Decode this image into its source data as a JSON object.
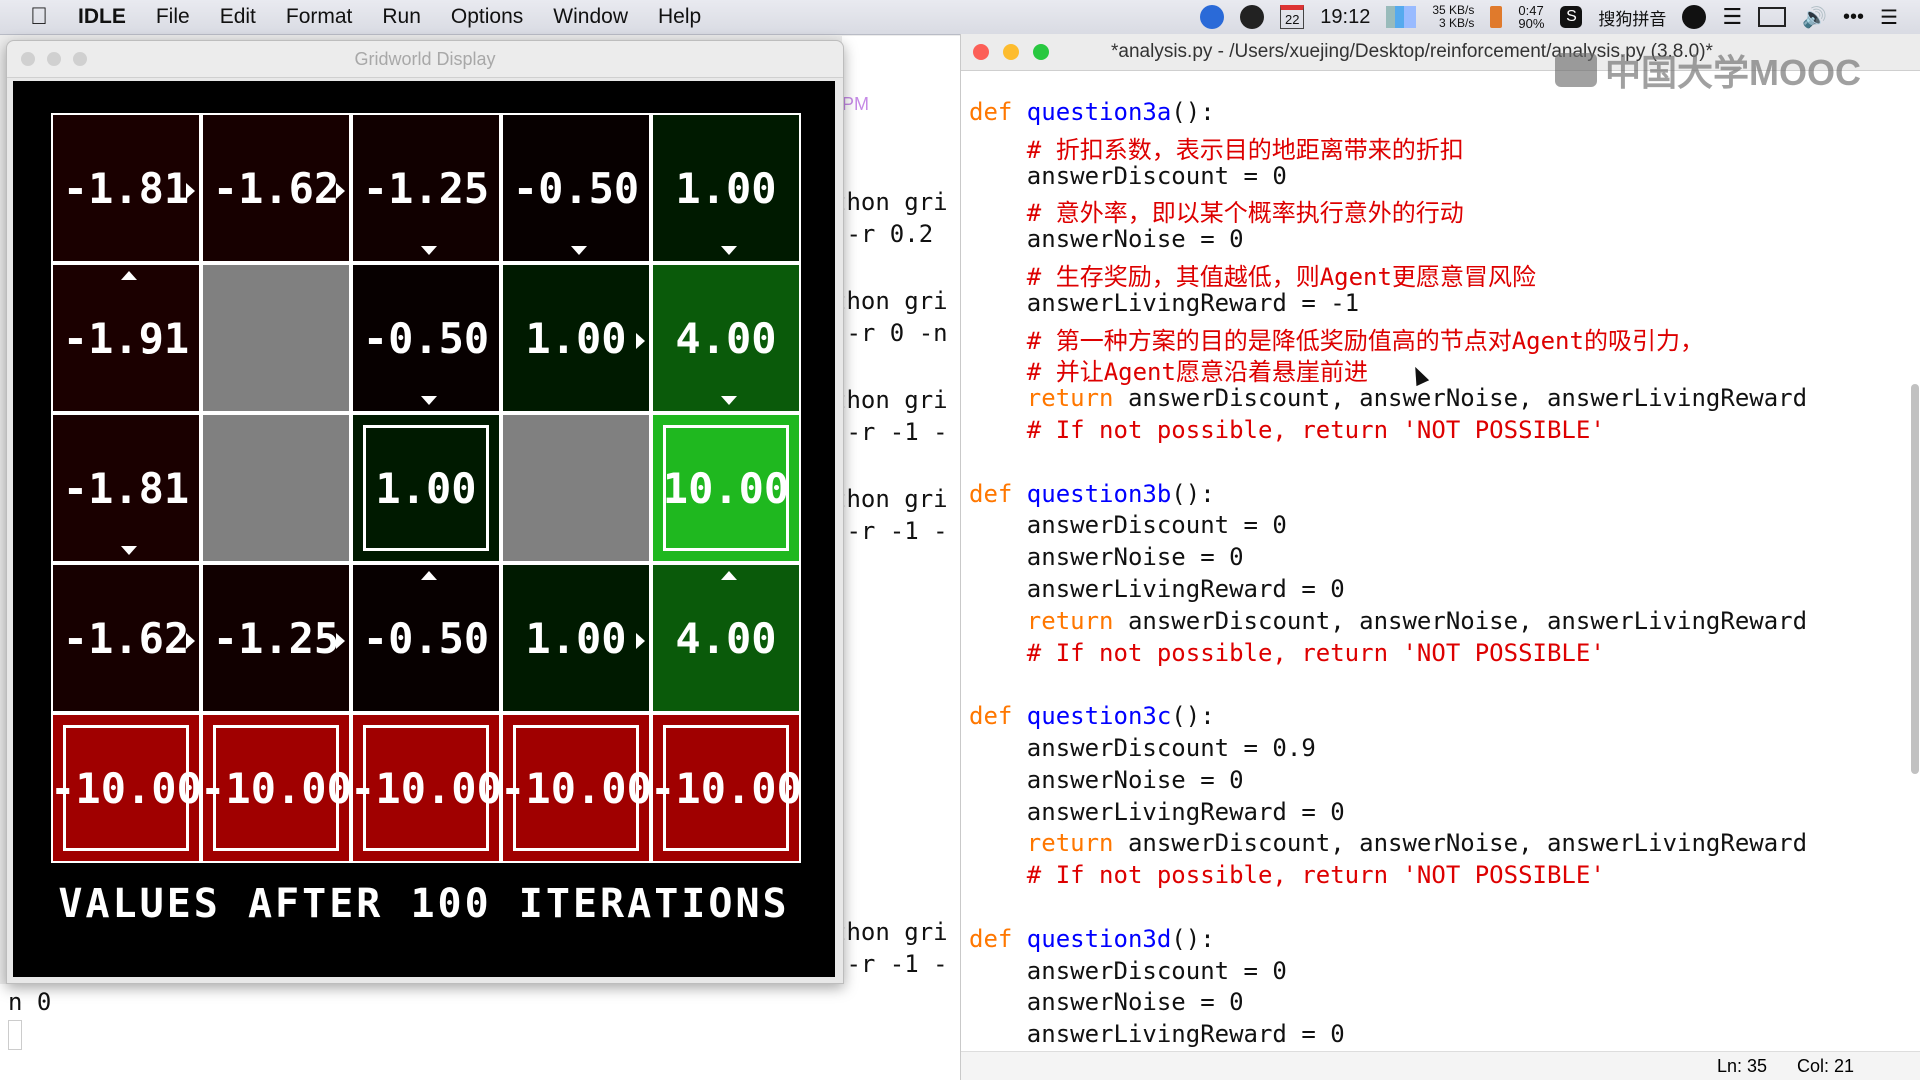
{
  "menubar": {
    "app": "IDLE",
    "menus": [
      "File",
      "Edit",
      "Format",
      "Run",
      "Options",
      "Window",
      "Help"
    ],
    "calendar_day": "22",
    "clock": "19:12",
    "net_up": "35 KB/s",
    "net_down": "3 KB/s",
    "battery_time": "0:47",
    "battery_pct": "90%",
    "ime": "搜狗拼音"
  },
  "gridworld": {
    "title": "Gridworld Display",
    "caption": "VALUES AFTER 100 ITERATIONS",
    "cells": [
      {
        "row": 0,
        "col": 0,
        "value": "-1.81",
        "bg": "#1a0000",
        "arrow": "right"
      },
      {
        "row": 0,
        "col": 1,
        "value": "-1.62",
        "bg": "#170000",
        "arrow": "right"
      },
      {
        "row": 0,
        "col": 2,
        "value": "-1.25",
        "bg": "#110000",
        "arrow": "down"
      },
      {
        "row": 0,
        "col": 3,
        "value": "-0.50",
        "bg": "#070000",
        "arrow": "down"
      },
      {
        "row": 0,
        "col": 4,
        "value": "1.00",
        "bg": "#001a00",
        "arrow": "down"
      },
      {
        "row": 1,
        "col": 0,
        "value": "-1.91",
        "bg": "#1b0000",
        "arrow": "up"
      },
      {
        "row": 1,
        "col": 1,
        "value": "",
        "bg": "#808080",
        "arrow": ""
      },
      {
        "row": 1,
        "col": 2,
        "value": "-0.50",
        "bg": "#070000",
        "arrow": "down"
      },
      {
        "row": 1,
        "col": 3,
        "value": "1.00",
        "bg": "#001a00",
        "arrow": "right"
      },
      {
        "row": 1,
        "col": 4,
        "value": "4.00",
        "bg": "#0a5a0a",
        "arrow": "down"
      },
      {
        "row": 2,
        "col": 0,
        "value": "-1.81",
        "bg": "#1a0000",
        "arrow": "down"
      },
      {
        "row": 2,
        "col": 1,
        "value": "",
        "bg": "#808080",
        "arrow": ""
      },
      {
        "row": 2,
        "col": 2,
        "value": "1.00",
        "bg": "#001a00",
        "arrow": "",
        "terminal": true
      },
      {
        "row": 2,
        "col": 3,
        "value": "",
        "bg": "#808080",
        "arrow": ""
      },
      {
        "row": 2,
        "col": 4,
        "value": "10.00",
        "bg": "#1fb81f",
        "arrow": "",
        "terminal": true
      },
      {
        "row": 3,
        "col": 0,
        "value": "-1.62",
        "bg": "#170000",
        "arrow": "right"
      },
      {
        "row": 3,
        "col": 1,
        "value": "-1.25",
        "bg": "#110000",
        "arrow": "right"
      },
      {
        "row": 3,
        "col": 2,
        "value": "-0.50",
        "bg": "#070000",
        "arrow": "up"
      },
      {
        "row": 3,
        "col": 3,
        "value": "1.00",
        "bg": "#001a00",
        "arrow": "right"
      },
      {
        "row": 3,
        "col": 4,
        "value": "4.00",
        "bg": "#0a5a0a",
        "arrow": "up"
      },
      {
        "row": 4,
        "col": 0,
        "value": "-10.00",
        "bg": "#a00000",
        "arrow": "",
        "terminal": true
      },
      {
        "row": 4,
        "col": 1,
        "value": "-10.00",
        "bg": "#a00000",
        "arrow": "",
        "terminal": true
      },
      {
        "row": 4,
        "col": 2,
        "value": "-10.00",
        "bg": "#a00000",
        "arrow": "",
        "terminal": true
      },
      {
        "row": 4,
        "col": 3,
        "value": "-10.00",
        "bg": "#a00000",
        "arrow": "",
        "terminal": true
      },
      {
        "row": 4,
        "col": 4,
        "value": "-10.00",
        "bg": "#a00000",
        "arrow": "",
        "terminal": true
      }
    ]
  },
  "shell": {
    "pm": "PM",
    "lines": [
      "thon gri",
      " -r 0.2",
      "thon gri",
      " -r 0 -n",
      "thon gri",
      " -r -1 -",
      "thon gri",
      " -r -1 -",
      "thon gri",
      " -r -1 -"
    ],
    "prompt": "n 0"
  },
  "editor": {
    "title": "*analysis.py - /Users/xuejing/Desktop/reinforcement/analysis.py (3.8.0)*",
    "watermark": "中国大学MOOC",
    "lines": [
      [
        {
          "t": "def ",
          "c": "kw"
        },
        {
          "t": "question3a",
          "c": "fn"
        },
        {
          "t": "():",
          "c": ""
        }
      ],
      [
        {
          "t": "    # 折扣系数，表示目的地距离带来的折扣",
          "c": "cm"
        }
      ],
      [
        {
          "t": "    answerDiscount = 0",
          "c": ""
        }
      ],
      [
        {
          "t": "    # 意外率，即以某个概率执行意外的行动",
          "c": "cm"
        }
      ],
      [
        {
          "t": "    answerNoise = 0",
          "c": ""
        }
      ],
      [
        {
          "t": "    # 生存奖励，其值越低，则Agent更愿意冒风险",
          "c": "cm"
        }
      ],
      [
        {
          "t": "    answerLivingReward = -1",
          "c": ""
        }
      ],
      [
        {
          "t": "    # 第一种方案的目的是降低奖励值高的节点对Agent的吸引力，",
          "c": "cm"
        }
      ],
      [
        {
          "t": "    # 并让Agent愿意沿着悬崖前进",
          "c": "cm"
        }
      ],
      [
        {
          "t": "    ",
          "c": ""
        },
        {
          "t": "return",
          "c": "kw"
        },
        {
          "t": " answerDiscount, answerNoise, answerLivingReward",
          "c": ""
        }
      ],
      [
        {
          "t": "    # If not possible, return 'NOT POSSIBLE'",
          "c": "cm"
        }
      ],
      [
        {
          "t": "",
          "c": ""
        }
      ],
      [
        {
          "t": "def ",
          "c": "kw"
        },
        {
          "t": "question3b",
          "c": "fn"
        },
        {
          "t": "():",
          "c": ""
        }
      ],
      [
        {
          "t": "    answerDiscount = 0",
          "c": ""
        }
      ],
      [
        {
          "t": "    answerNoise = 0",
          "c": ""
        }
      ],
      [
        {
          "t": "    answerLivingReward = 0",
          "c": ""
        }
      ],
      [
        {
          "t": "    ",
          "c": ""
        },
        {
          "t": "return",
          "c": "kw"
        },
        {
          "t": " answerDiscount, answerNoise, answerLivingReward",
          "c": ""
        }
      ],
      [
        {
          "t": "    # If not possible, return 'NOT POSSIBLE'",
          "c": "cm"
        }
      ],
      [
        {
          "t": "",
          "c": ""
        }
      ],
      [
        {
          "t": "def ",
          "c": "kw"
        },
        {
          "t": "question3c",
          "c": "fn"
        },
        {
          "t": "():",
          "c": ""
        }
      ],
      [
        {
          "t": "    answerDiscount = 0.9",
          "c": ""
        }
      ],
      [
        {
          "t": "    answerNoise = 0",
          "c": ""
        }
      ],
      [
        {
          "t": "    answerLivingReward = 0",
          "c": ""
        }
      ],
      [
        {
          "t": "    ",
          "c": ""
        },
        {
          "t": "return",
          "c": "kw"
        },
        {
          "t": " answerDiscount, answerNoise, answerLivingReward",
          "c": ""
        }
      ],
      [
        {
          "t": "    # If not possible, return 'NOT POSSIBLE'",
          "c": "cm"
        }
      ],
      [
        {
          "t": "",
          "c": ""
        }
      ],
      [
        {
          "t": "def ",
          "c": "kw"
        },
        {
          "t": "question3d",
          "c": "fn"
        },
        {
          "t": "():",
          "c": ""
        }
      ],
      [
        {
          "t": "    answerDiscount = 0",
          "c": ""
        }
      ],
      [
        {
          "t": "    answerNoise = 0",
          "c": ""
        }
      ],
      [
        {
          "t": "    answerLivingReward = 0",
          "c": ""
        }
      ]
    ],
    "status_ln": "Ln: 35",
    "status_col": "Col: 21"
  }
}
